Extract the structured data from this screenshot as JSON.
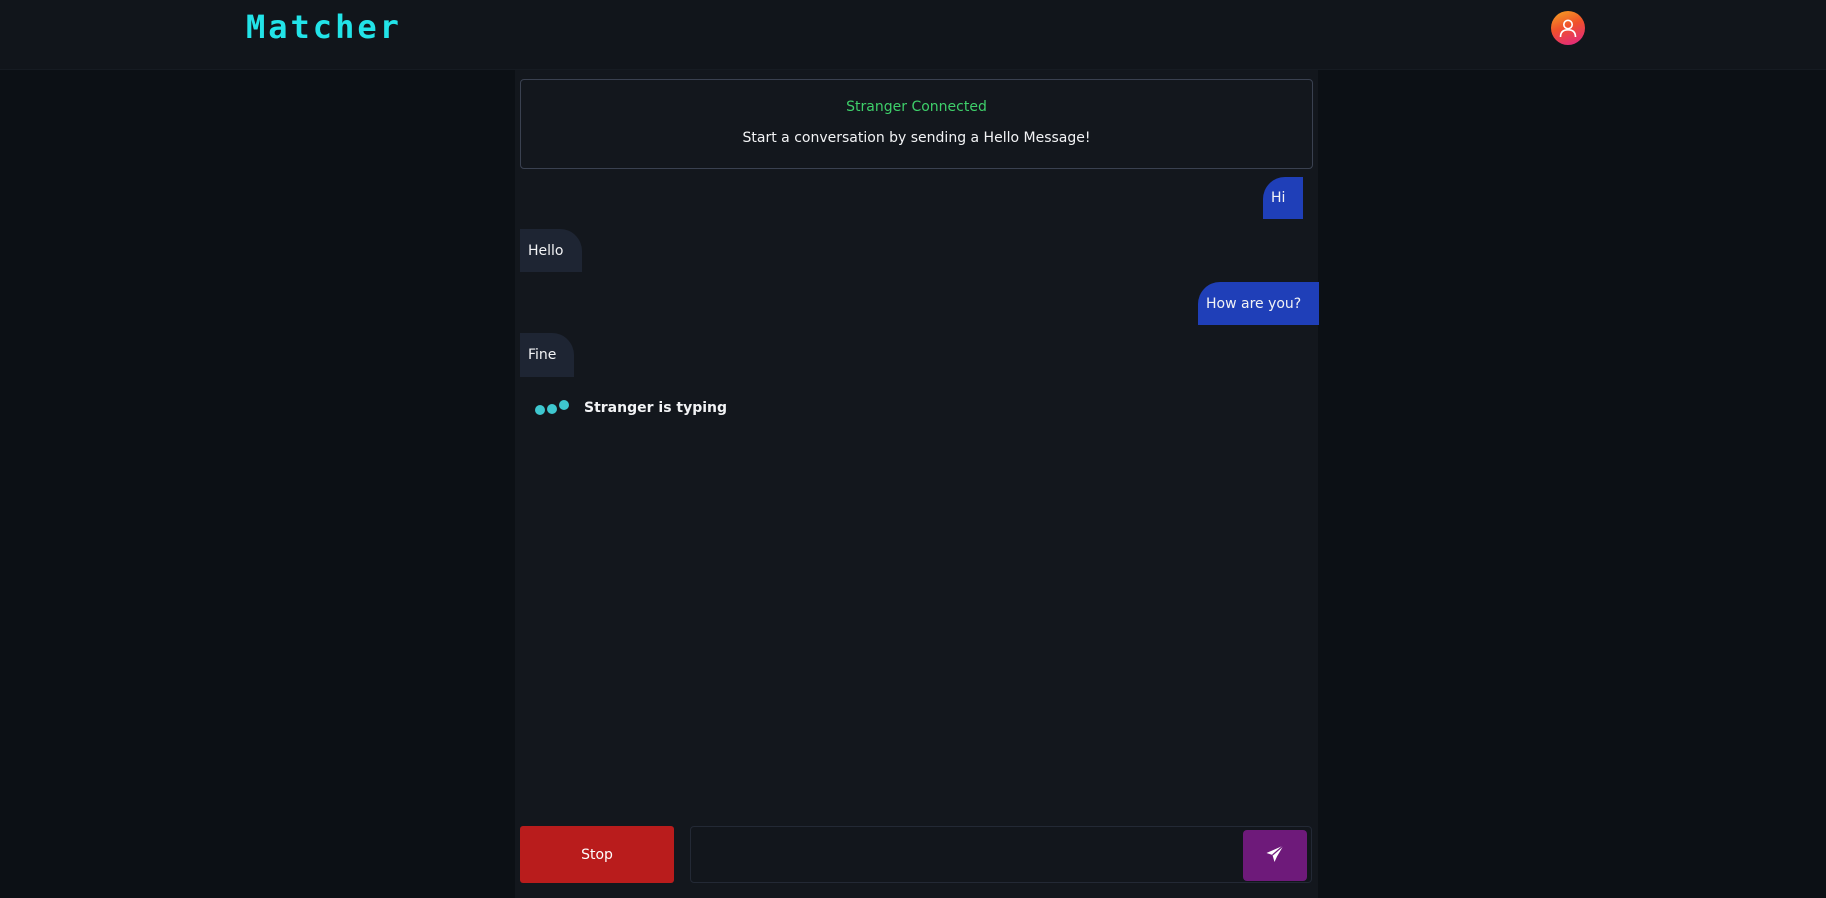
{
  "header": {
    "brand": "Matcher",
    "avatar_icon": "user-avatar-icon"
  },
  "banner": {
    "status": "Stranger Connected",
    "hint": "Start a conversation by sending a Hello Message!"
  },
  "messages": [
    {
      "from": "me",
      "text": "Hi"
    },
    {
      "from": "stranger",
      "text": "Hello"
    },
    {
      "from": "me",
      "text": "How are you?"
    },
    {
      "from": "stranger",
      "text": "Fine"
    }
  ],
  "typing": {
    "label": "Stranger is typing"
  },
  "composer": {
    "stop_label": "Stop",
    "input_value": "",
    "input_placeholder": "",
    "send_icon": "paper-plane-icon"
  },
  "colors": {
    "brand": "#22e3e8",
    "status_connected": "#3ecf6a",
    "sent_bubble": "#1f3fb8",
    "received_bubble": "#1e2533",
    "stop_button": "#b91c1c",
    "send_button": "#6e1a7a",
    "typing_dots": "#3ec7cf"
  }
}
